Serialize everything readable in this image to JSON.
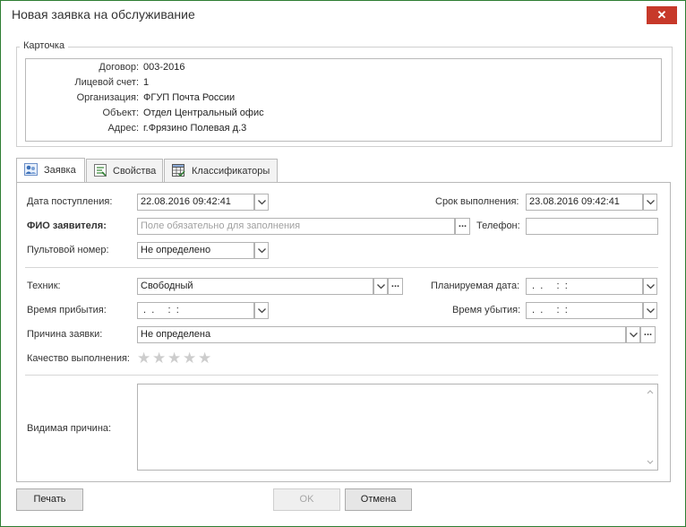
{
  "window": {
    "title": "Новая заявка на обслуживание",
    "close_icon": "close-icon"
  },
  "card": {
    "caption": "Карточка",
    "rows": [
      {
        "label": "Договор:",
        "value": "003-2016"
      },
      {
        "label": "Лицевой счет:",
        "value": "1"
      },
      {
        "label": "Организация:",
        "value": "ФГУП Почта России"
      },
      {
        "label": "Объект:",
        "value": "Отдел Центральный офис"
      },
      {
        "label": "Адрес:",
        "value": "г.Фрязино Полевая д.3"
      }
    ]
  },
  "tabs": [
    {
      "label": "Заявка",
      "icon": "people-icon",
      "active": true
    },
    {
      "label": "Свойства",
      "icon": "properties-icon",
      "active": false
    },
    {
      "label": "Классификаторы",
      "icon": "table-icon",
      "active": false
    }
  ],
  "form": {
    "date_received": {
      "label": "Дата поступления:",
      "value": "22.08.2016 09:42:41"
    },
    "due_date": {
      "label": "Срок выполнения:",
      "value": "23.08.2016 09:42:41"
    },
    "applicant": {
      "label": "ФИО заявителя:",
      "placeholder": "Поле обязательно для заполнения"
    },
    "phone": {
      "label": "Телефон:",
      "value": ""
    },
    "console_number": {
      "label": "Пультовой номер:",
      "value": "Не определено"
    },
    "technician": {
      "label": "Техник:",
      "value": "Свободный"
    },
    "planned_date": {
      "label": "Планируемая дата:",
      "value": " .  .     :  :"
    },
    "arrival_time": {
      "label": "Время прибытия:",
      "value": " .  .     :  :"
    },
    "departure_time": {
      "label": "Время убытия:",
      "value": " .  .     :  :"
    },
    "reason": {
      "label": "Причина заявки:",
      "value": "Не определена"
    },
    "quality": {
      "label": "Качество выполнения:",
      "rating": 0,
      "max": 5
    },
    "visible_reason": {
      "label": "Видимая причина:",
      "value": ""
    }
  },
  "buttons": {
    "print": "Печать",
    "ok": "OK",
    "cancel": "Отмена"
  },
  "colors": {
    "close": "#c7392a",
    "border": "#b3b3b3",
    "frame": "#2e7d32"
  }
}
